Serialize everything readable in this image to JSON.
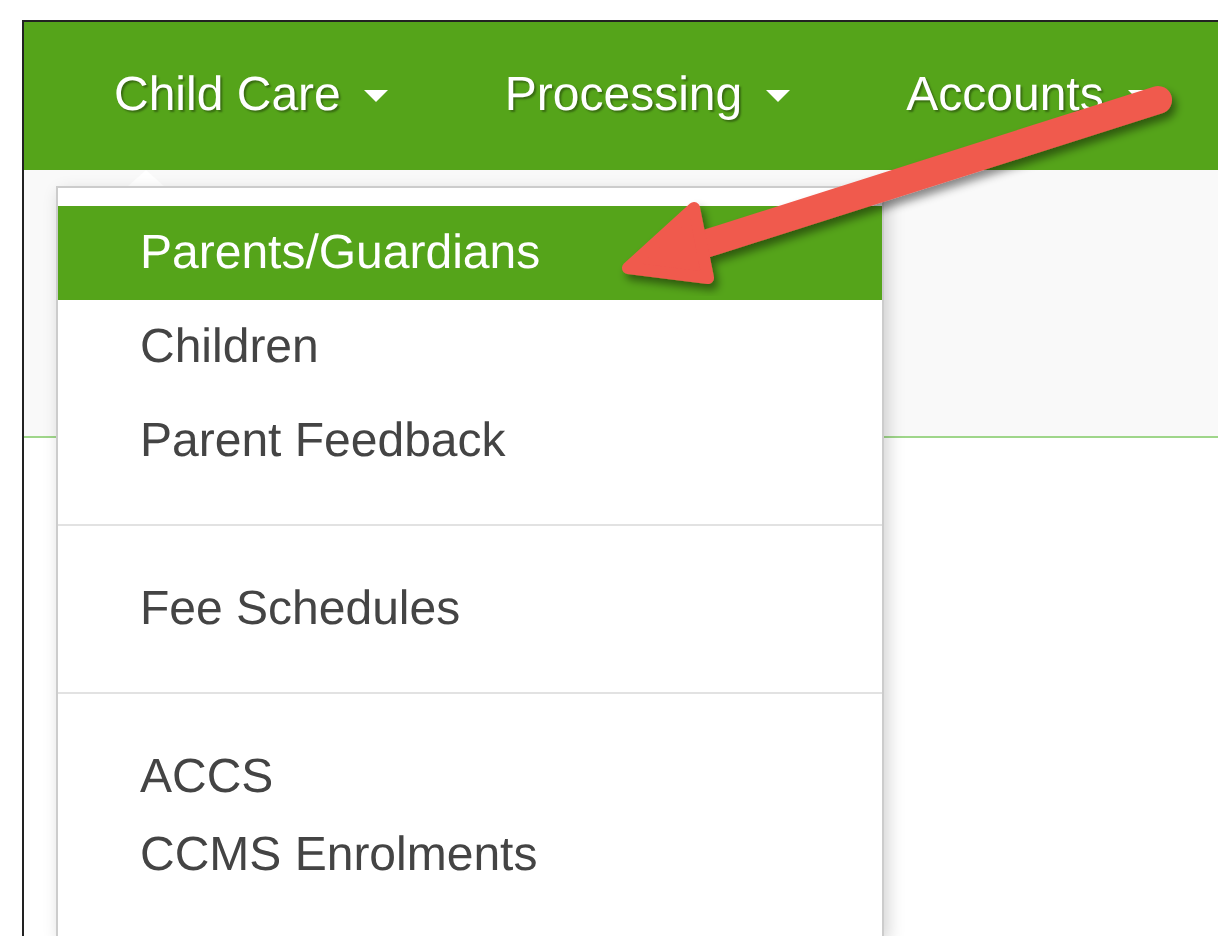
{
  "nav": {
    "items": [
      {
        "label": "Child Care"
      },
      {
        "label": "Processing"
      },
      {
        "label": "Accounts"
      }
    ]
  },
  "dropdown": {
    "groups": [
      {
        "items": [
          {
            "label": "Parents/Guardians",
            "selected": true
          },
          {
            "label": "Children",
            "selected": false
          },
          {
            "label": "Parent Feedback",
            "selected": false
          }
        ]
      },
      {
        "items": [
          {
            "label": "Fee Schedules",
            "selected": false
          }
        ]
      },
      {
        "items": [
          {
            "label": "ACCS",
            "selected": false
          },
          {
            "label": "CCMS Enrolments",
            "selected": false
          }
        ]
      }
    ]
  },
  "annotation": {
    "kind": "arrow"
  }
}
